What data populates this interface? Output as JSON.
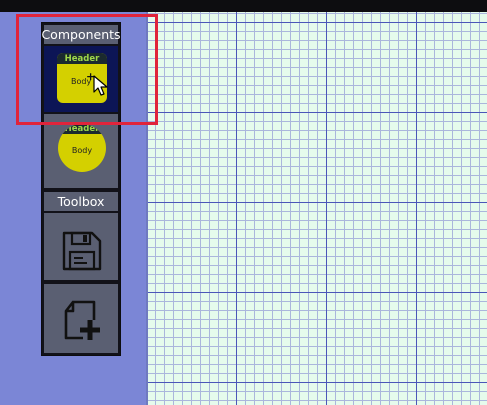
{
  "sidebar": {
    "components_title": "Components",
    "toolbox_title": "Toolbox",
    "components": [
      {
        "shape": "rectangle",
        "header": "Header",
        "body": "Body",
        "selected": true
      },
      {
        "shape": "circle",
        "header": "Header",
        "body": "Body",
        "selected": false
      }
    ],
    "tools": [
      {
        "icon": "save-icon"
      },
      {
        "icon": "new-document-icon"
      }
    ],
    "drag_indicator": "+"
  },
  "colors": {
    "sidebar": "#7b86d6",
    "tile": "#5a5f72",
    "tile_selected": "#0c1556",
    "component_fill": "#d4d000",
    "header_text": "#9fd84a",
    "canvas": "#e5fbec",
    "grid_major": "#4b57b8",
    "grid_minor": "#aab6dc",
    "highlight": "#e0243b"
  }
}
